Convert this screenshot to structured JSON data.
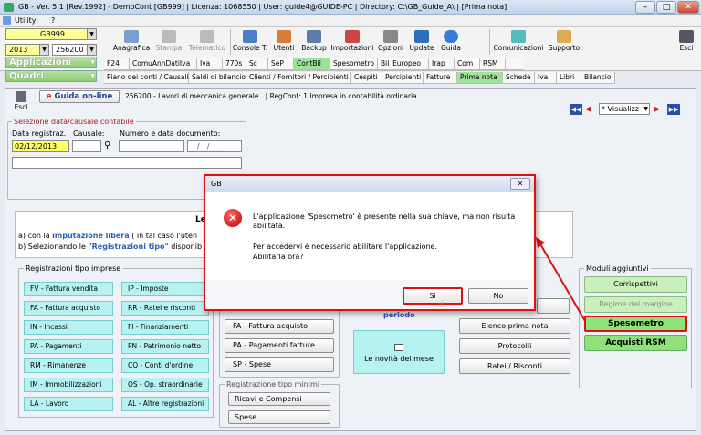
{
  "window": {
    "title": "GB - Ver. 5.1 [Rev.1992] - DemoCont [GB999]     | Licenza: 1068550 | User: guide4@GUIDE-PC | Directory: C:\\GB_Guide_A\\ | [Prima nota]"
  },
  "menu": {
    "utility": "Utility",
    "help": "?"
  },
  "selectors": {
    "company": "GB999",
    "year": "2013",
    "code": "256200 -",
    "applicazioni": "Applicazioni",
    "quadri": "Quadri"
  },
  "toolbar": {
    "anagrafica": "Anagrafica",
    "stampa": "Stampa",
    "telematico": "Telematico",
    "console": "Console T.",
    "utenti": "Utenti",
    "backup": "Backup",
    "importazioni": "Importazioni",
    "opzioni": "Opzioni",
    "update": "Update",
    "guida": "Guida",
    "comunicazioni": "Comunicazioni",
    "supporto": "Supporto",
    "esci": "Esci"
  },
  "app_tabs": [
    "F24",
    "ComuAnnDatiIva",
    "Iva",
    "770s",
    "Sc",
    "SeP",
    "ContBil",
    "Spesometro",
    "Bil_Europeo",
    "Irap",
    "Com",
    "RSM"
  ],
  "sub_tabs": [
    "Piano dei conti / Causali",
    "Saldi di bilancio",
    "Clienti / Fornitori / Percipienti",
    "Cespiti",
    "Percipienti",
    "Fatture",
    "Prima nota",
    "Schede",
    "Iva",
    "Libri",
    "Bilancio"
  ],
  "header": {
    "esci": "Esci",
    "guida": "Guida on-line",
    "info": "256200 - Lavori di meccanica generale..  | RegCont: 1 Impresa  in contabilità ordinaria..",
    "visualizza": "* Visualizz"
  },
  "form": {
    "section": "Selezione data/causale contabile",
    "data_label": "Data registraz.",
    "causale_label": "Causale:",
    "numero_label": "Numero e data documento:",
    "data_value": "02/12/2013",
    "date_placeholder": "__/__/____"
  },
  "intro": {
    "heading": "Le",
    "line1_pre": "a) con la ",
    "line1_link": "imputazione libera",
    "line1_post": " ( in tal caso l'uten",
    "line2_pre": "b) Selezionando le ",
    "line2_link": "\"Registrazioni tipo\"",
    "line2_post": " disponib"
  },
  "reg_imprese": {
    "label": "Registrazioni tipo imprese",
    "left": [
      "FV - Fattura vendita",
      "FA - Fattura acquisto",
      "IN - Incassi",
      "PA - Pagamenti",
      "RM - Rimanenze",
      "IM - Immobilizzazioni",
      "LA - Lavoro"
    ],
    "right": [
      "IP - Imposte",
      "RR - Ratei e risconti",
      "FI - Finanziamenti",
      "PN - Patrimonio netto",
      "CO - Conti d'ordine",
      "OS - Op. straordinarie",
      "AL - Altre registrazioni"
    ]
  },
  "reg_mid": [
    "FA - Fattura acquisto",
    "PA - Pagamenti fatture",
    "SP - Spese"
  ],
  "reg_minimi": {
    "label": "Registrazione tipo minimi",
    "items": [
      "Ricavi e Compensi",
      "Spese"
    ]
  },
  "periodo": "periodo",
  "novita": "Le novità del mese",
  "right_buttons": [
    "Elenco prima nota",
    "Protocolli",
    "Ratei / Risconti"
  ],
  "moduli": {
    "label": "Moduli aggiuntivi",
    "items": [
      "Corrispettivi",
      "Regime del margine",
      "Spesometro",
      "Acquisti RSM"
    ]
  },
  "dialog": {
    "title": "GB",
    "line1": "L'applicazione 'Spesometro' è presente nella sua chiave, ma non risulta",
    "line2": "abilitata.",
    "line3": "Per accedervi è necessario abilitare l'applicazione.",
    "line4": "Abilitarla ora?",
    "yes": "Sì",
    "no": "No"
  }
}
